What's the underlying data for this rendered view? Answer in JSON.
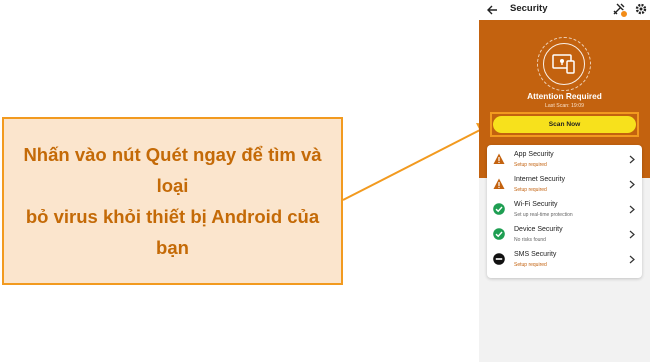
{
  "callout": {
    "line1": "Nhấn vào nút Quét ngay để tìm và loại",
    "line2": "bỏ virus khỏi thiết bị Android của bạn"
  },
  "app": {
    "title": "Security",
    "status_title": "Attention Required",
    "last_scan": "Last Scan: 19:09",
    "scan_button": "Scan Now",
    "colors": {
      "hero": "#c3620f",
      "scan_button": "#f7e11c",
      "highlight": "#f29a1f",
      "ok": "#1e9e52",
      "warn": "#c3620f"
    }
  },
  "security_items": [
    {
      "title": "App Security",
      "status": "Setup required",
      "state": "warning",
      "icon": "warning-icon"
    },
    {
      "title": "Internet Security",
      "status": "Setup required",
      "state": "warning",
      "icon": "warning-icon"
    },
    {
      "title": "Wi-Fi Security",
      "status": "Set up real-time protection",
      "state": "ok",
      "icon": "check-circle-icon"
    },
    {
      "title": "Device Security",
      "status": "No risks found",
      "state": "ok",
      "icon": "check-circle-icon"
    },
    {
      "title": "SMS Security",
      "status": "Setup required",
      "state": "blocked",
      "icon": "minus-circle-icon"
    }
  ]
}
